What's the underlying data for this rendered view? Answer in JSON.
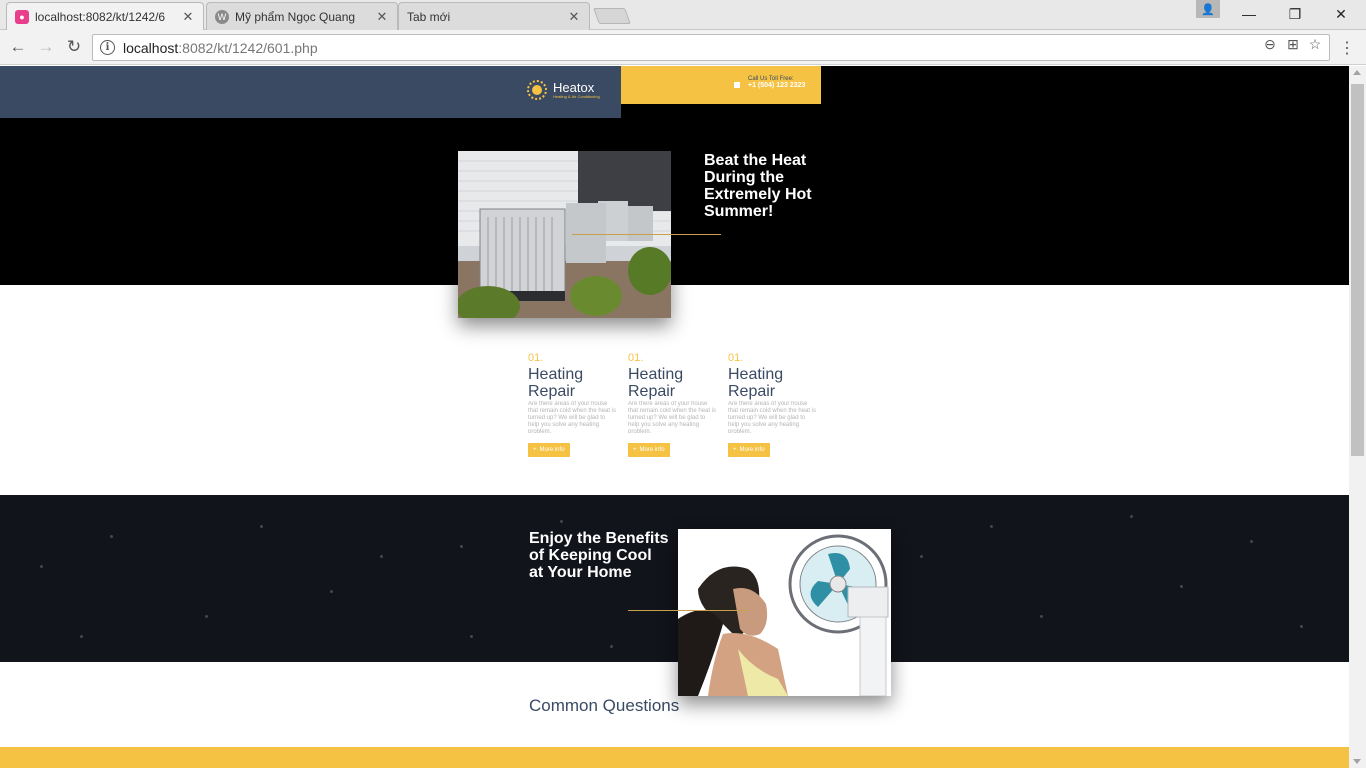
{
  "browser": {
    "tabs": [
      {
        "title": "localhost:8082/kt/1242/6",
        "favicon": "dev-server-icon",
        "active": true
      },
      {
        "title": "Mỹ phẩm Ngọc Quang",
        "favicon": "wordpress-icon",
        "active": false
      },
      {
        "title": "Tab mới",
        "favicon": "",
        "active": false
      }
    ],
    "url_host": "localhost",
    "url_path": ":8082/kt/1242/601.php"
  },
  "header": {
    "logo_name": "Heatox",
    "logo_tagline": "Heating & Air Conditioning",
    "call_label": "Call Us Toll Free:",
    "call_number": "+1 (504) 123 2323"
  },
  "hero": {
    "title": "Beat the Heat During the Extremely Hot Summer!"
  },
  "services": [
    {
      "num": "01.",
      "title": "Heating Repair",
      "desc": "Are there areas of your house that remain cold when the heat is turned up? We will be glad to help you solve any heating problem.",
      "button": "More info"
    },
    {
      "num": "01.",
      "title": "Heating Repair",
      "desc": "Are there areas of your house that remain cold when the heat is turned up? We will be glad to help you solve any heating problem.",
      "button": "More info"
    },
    {
      "num": "01.",
      "title": "Heating Repair",
      "desc": "Are there areas of your house that remain cold when the heat is turned up? We will be glad to help you solve any heating problem.",
      "button": "More info"
    }
  ],
  "benefits": {
    "title": "Enjoy the Benefits of Keeping Cool at Your Home"
  },
  "faq": {
    "title": "Common Questions"
  },
  "colors": {
    "accent": "#f5c243",
    "navy": "#3a4a63",
    "dark": "#12141b"
  }
}
